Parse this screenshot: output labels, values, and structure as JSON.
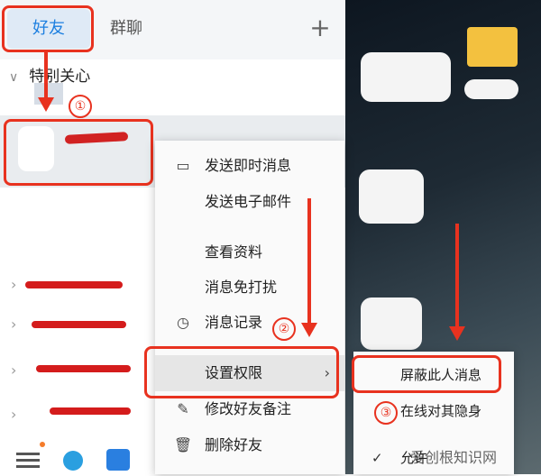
{
  "tabs": {
    "friends": "好友",
    "groups": "群聊"
  },
  "plus_icon": "plus-icon",
  "special_group": "特别关心",
  "menu": {
    "items": [
      {
        "label": "发送即时消息",
        "icon": "chat-icon"
      },
      {
        "label": "发送电子邮件",
        "icon": ""
      },
      {
        "label": "查看资料",
        "icon": ""
      },
      {
        "label": "消息免打扰",
        "icon": ""
      },
      {
        "label": "消息记录",
        "icon": "clock-icon"
      },
      {
        "label": "设置权限",
        "icon": ""
      },
      {
        "label": "修改好友备注",
        "icon": "edit-icon"
      },
      {
        "label": "删除好友",
        "icon": "trash-icon"
      }
    ]
  },
  "submenu": {
    "items": [
      {
        "label": "屏蔽此人消息"
      },
      {
        "label": "在线对其隐身"
      },
      {
        "label": "允许"
      }
    ]
  },
  "annotations": {
    "step1": "①",
    "step2": "②",
    "step3": "③"
  },
  "watermark": "爱创根知识网",
  "colors": {
    "accent": "#1c7fe0",
    "annotation": "#e8321f"
  }
}
